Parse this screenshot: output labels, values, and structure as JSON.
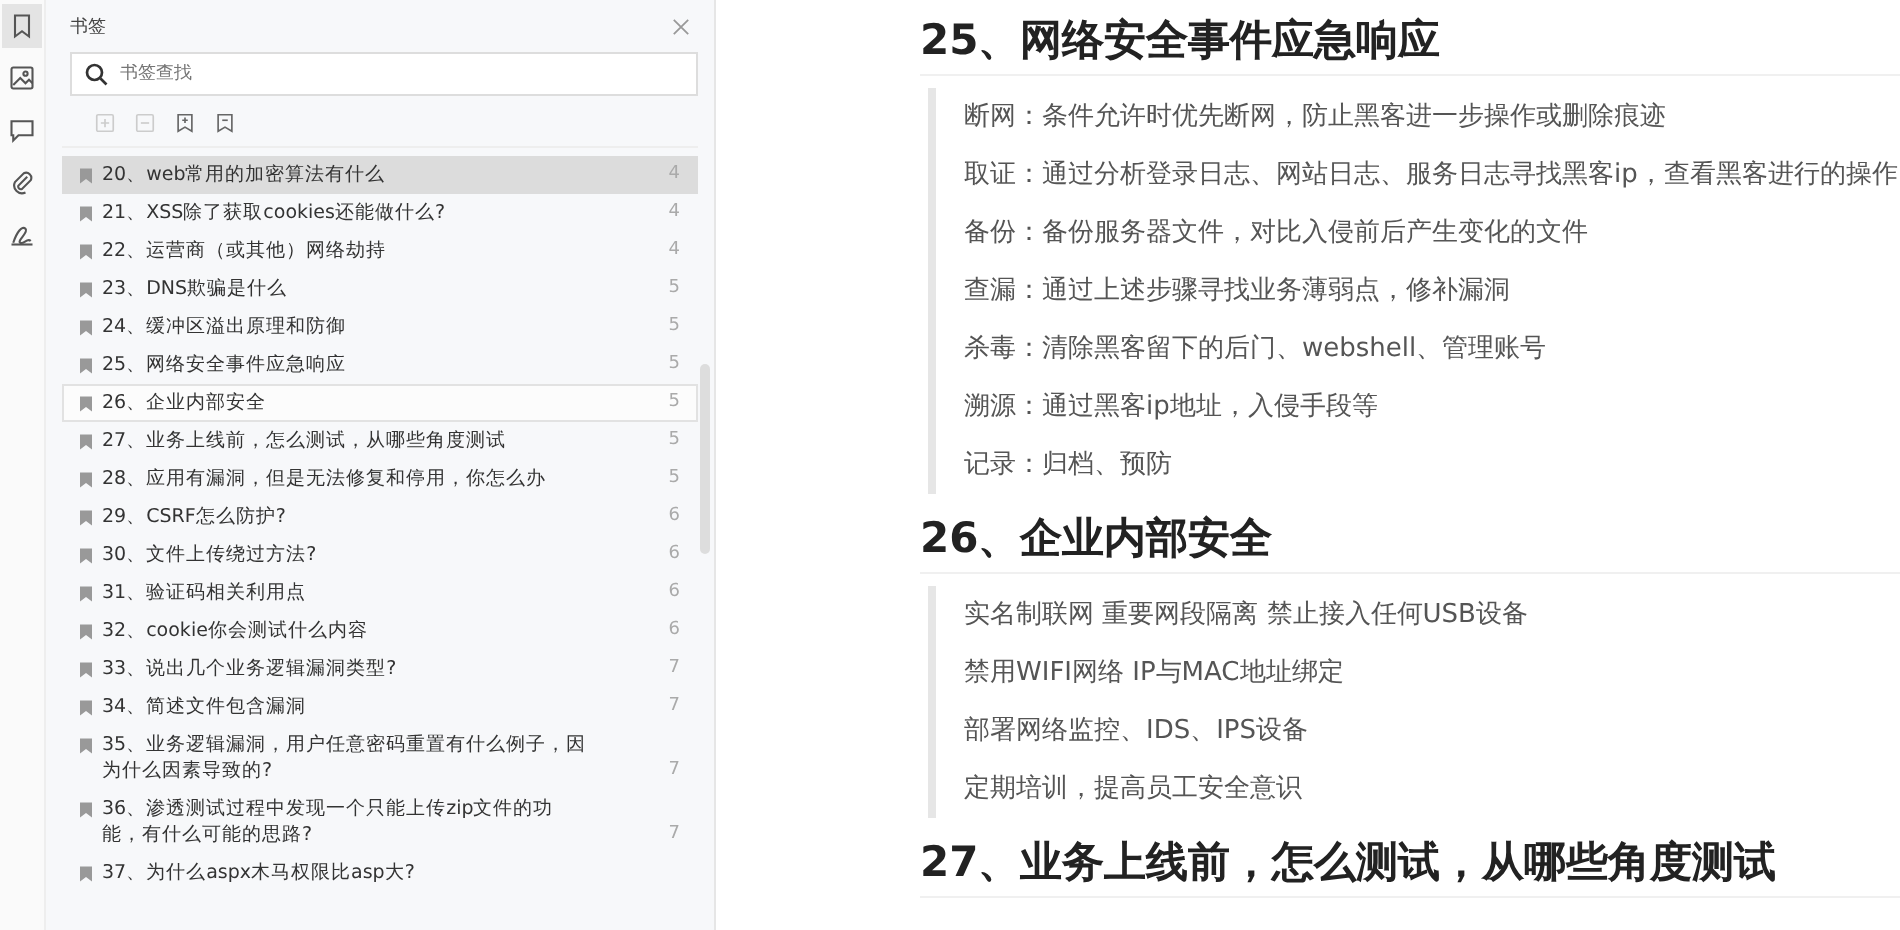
{
  "rail": [
    {
      "kind": "bookmark",
      "selected": true
    },
    {
      "kind": "image",
      "selected": false
    },
    {
      "kind": "comment",
      "selected": false
    },
    {
      "kind": "attachment",
      "selected": false
    },
    {
      "kind": "signature",
      "selected": false
    }
  ],
  "panel": {
    "title": "书签",
    "search": {
      "placeholder": "书签查找"
    },
    "toolbar": [
      {
        "kind": "expand",
        "disabled": true
      },
      {
        "kind": "collapse",
        "disabled": true
      },
      {
        "kind": "add",
        "disabled": false
      },
      {
        "kind": "remove",
        "disabled": false
      }
    ],
    "bookmarks": [
      {
        "label": "20、web常用的加密算法有什么",
        "page": "4",
        "selected": true,
        "hovered": false
      },
      {
        "label": "21、XSS除了获取cookies还能做什么?",
        "page": "4",
        "selected": false,
        "hovered": false
      },
      {
        "label": "22、运营商（或其他）网络劫持",
        "page": "4",
        "selected": false,
        "hovered": false
      },
      {
        "label": "23、DNS欺骗是什么",
        "page": "5",
        "selected": false,
        "hovered": false
      },
      {
        "label": "24、缓冲区溢出原理和防御",
        "page": "5",
        "selected": false,
        "hovered": false
      },
      {
        "label": "25、网络安全事件应急响应",
        "page": "5",
        "selected": false,
        "hovered": false
      },
      {
        "label": "26、企业内部安全",
        "page": "5",
        "selected": false,
        "hovered": true
      },
      {
        "label": "27、业务上线前，怎么测试，从哪些角度测试",
        "page": "5",
        "selected": false,
        "hovered": false
      },
      {
        "label": "28、应用有漏洞，但是无法修复和停用，你怎么办",
        "page": "5",
        "selected": false,
        "hovered": false
      },
      {
        "label": "29、CSRF怎么防护?",
        "page": "6",
        "selected": false,
        "hovered": false
      },
      {
        "label": "30、文件上传绕过方法?",
        "page": "6",
        "selected": false,
        "hovered": false
      },
      {
        "label": "31、验证码相关利用点",
        "page": "6",
        "selected": false,
        "hovered": false
      },
      {
        "label": "32、cookie你会测试什么内容",
        "page": "6",
        "selected": false,
        "hovered": false
      },
      {
        "label": "33、说出几个业务逻辑漏洞类型?",
        "page": "7",
        "selected": false,
        "hovered": false
      },
      {
        "label": "34、简述文件包含漏洞",
        "page": "7",
        "selected": false,
        "hovered": false
      },
      {
        "label": "35、业务逻辑漏洞，用户任意密码重置有什么例子，因为什么因素导致的?",
        "page": "7",
        "selected": false,
        "hovered": false
      },
      {
        "label": "36、渗透测试过程中发现一个只能上传zip文件的功能，有什么可能的思路?",
        "page": "7",
        "selected": false,
        "hovered": false
      },
      {
        "label": "37、为什么aspx木马权限比asp大?",
        "selected": false,
        "hovered": false
      }
    ]
  },
  "document": [
    {
      "heading": "25、网络安全事件应急响应",
      "lines": [
        "断网：条件允许时优先断网，防止黑客进一步操作或删除痕迹",
        "取证：通过分析登录日志、网站日志、服务日志寻找黑客ip，查看黑客进行的操作",
        "备份：备份服务器文件，对比入侵前后产生变化的文件",
        "查漏：通过上述步骤寻找业务薄弱点，修补漏洞",
        "杀毒：清除黑客留下的后门、webshell、管理账号",
        "溯源：通过黑客ip地址，入侵手段等",
        "记录：归档、预防"
      ]
    },
    {
      "heading": "26、企业内部安全",
      "lines": [
        "实名制联网 重要网段隔离 禁止接入任何USB设备",
        "禁用WIFI网络 IP与MAC地址绑定",
        "部署网络监控、IDS、IPS设备",
        "定期培训，提高员工安全意识"
      ]
    },
    {
      "heading": "27、业务上线前，怎么测试，从哪些角度测试"
    }
  ]
}
